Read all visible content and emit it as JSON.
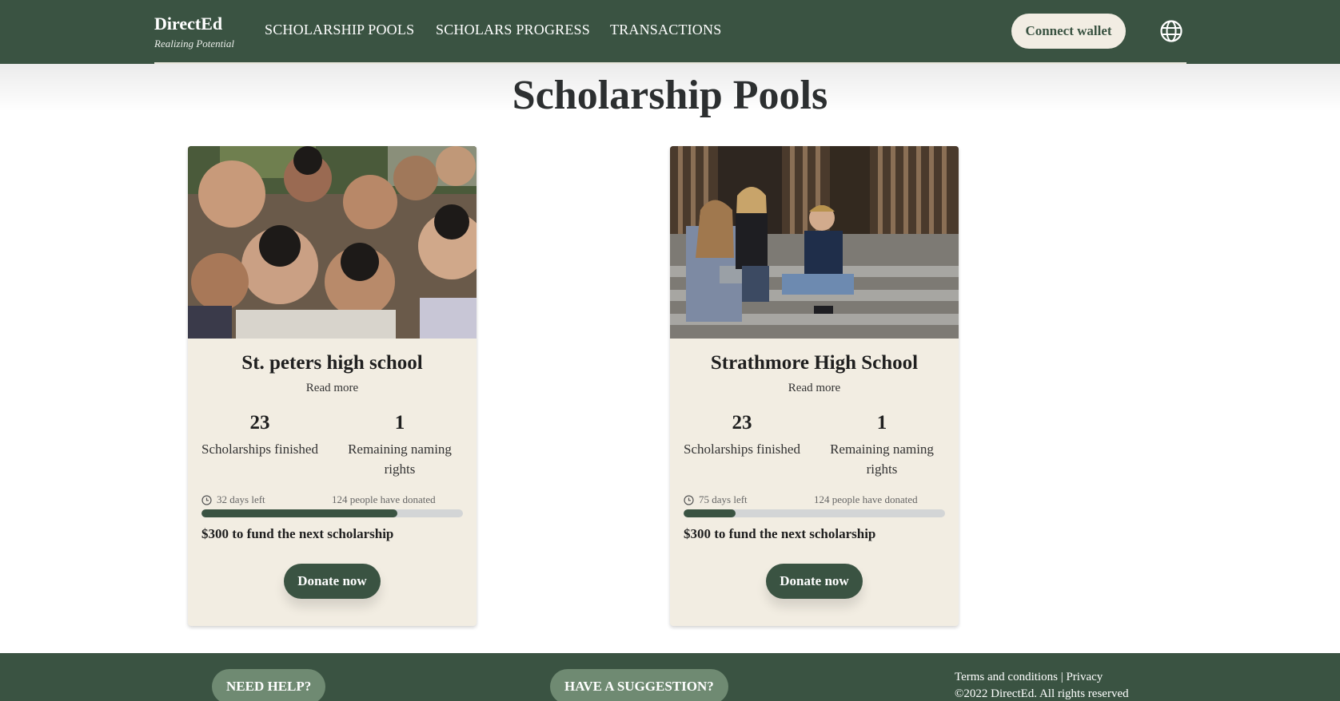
{
  "header": {
    "brand_name": "DirectEd",
    "brand_tagline": "Realizing Potential",
    "nav": [
      "SCHOLARSHIP POOLS",
      "SCHOLARS PROGRESS",
      "TRANSACTIONS"
    ],
    "connect_label": "Connect wallet",
    "globe_icon": "globe-icon"
  },
  "page_title": "Scholarship Pools",
  "pools": [
    {
      "name": "St. peters high school",
      "read_more": "Read more",
      "scholarships_finished": "23",
      "scholarships_finished_label": "Scholarships finished",
      "naming_rights": "1",
      "naming_rights_label": "Remaining naming rights",
      "days_left": "32 days left",
      "donated": "124 people have donated",
      "progress": 0.75,
      "fund_text": "$300 to fund the next scholarship",
      "donate_label": "Donate now"
    },
    {
      "name": "Strathmore High School",
      "read_more": "Read more",
      "scholarships_finished": "23",
      "scholarships_finished_label": "Scholarships finished",
      "naming_rights": "1",
      "naming_rights_label": "Remaining naming rights",
      "days_left": "75 days left",
      "donated": "124 people have donated",
      "progress": 0.2,
      "fund_text": "$300 to fund the next scholarship",
      "donate_label": "Donate now"
    }
  ],
  "footer": {
    "help_label": "NEED HELP?",
    "suggestion_label": "HAVE A SUGGESTION?",
    "terms": "Terms and conditions",
    "separator": " | ",
    "privacy": "Privacy",
    "copyright": "©2022 DirectEd. All rights reserved"
  },
  "colors": {
    "primary": "#3a5342",
    "card_bg": "#f2ede2",
    "button_light": "#f2ede3",
    "footer_button": "#6f8a72"
  }
}
